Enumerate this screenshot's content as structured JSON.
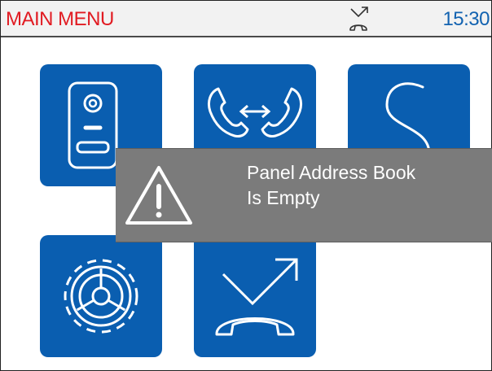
{
  "header": {
    "title": "MAIN MENU",
    "time": "15:30",
    "status_icon": "call-forward-icon"
  },
  "tiles": [
    {
      "icon": "door-entry-panel-icon"
    },
    {
      "icon": "intercom-call-icon"
    },
    {
      "icon": "s-curve-icon"
    },
    {
      "icon": "settings-gear-icon"
    },
    {
      "icon": "call-divert-icon"
    }
  ],
  "popup": {
    "icon": "warning-icon",
    "line1": "Panel Address Book",
    "line2": "Is Empty"
  },
  "colors": {
    "title": "#e11b22",
    "clock": "#1262b0",
    "tile": "#0a5eb0",
    "popup": "#7b7b7b"
  }
}
